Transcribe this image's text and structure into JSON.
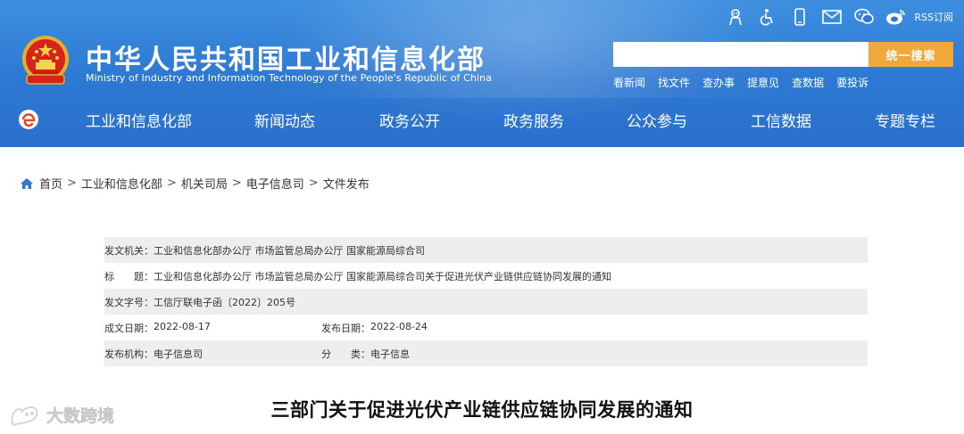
{
  "header": {
    "title_cn": "中华人民共和国工业和信息化部",
    "title_en": "Ministry of Industry and Information Technology of the People's Republic of China",
    "tools": {
      "rss_label": "RSS订阅"
    },
    "search": {
      "value": "",
      "placeholder": "",
      "button_label": "统一搜索"
    },
    "quicklinks": [
      "看新闻",
      "找文件",
      "查办事",
      "提意见",
      "查数据",
      "要投诉"
    ]
  },
  "nav": {
    "items": [
      "工业和信息化部",
      "新闻动态",
      "政务公开",
      "政务服务",
      "公众参与",
      "工信数据",
      "专题专栏"
    ]
  },
  "breadcrumb": [
    "首页",
    "工业和信息化部",
    "机关司局",
    "电子信息司",
    "文件发布"
  ],
  "meta": {
    "issuer_label": "发文机关：",
    "issuer": "工业和信息化部办公厅 市场监管总局办公厅 国家能源局综合司",
    "title_label": "标　　题：",
    "title": "工业和信息化部办公厅 市场监管总局办公厅 国家能源局综合司关于促进光伏产业链供应链协同发展的通知",
    "docno_label": "发文字号：",
    "docno": "工信厅联电子函〔2022〕205号",
    "written_label": "成文日期：",
    "written": "2022-08-17",
    "published_label": "发布日期：",
    "published": "2022-08-24",
    "agency_label": "发布机构：",
    "agency": "电子信息司",
    "category_label": "分　　类：",
    "category": "电子信息"
  },
  "article": {
    "title": "三部门关于促进光伏产业链供应链协同发展的通知"
  },
  "watermark": {
    "text": "大数跨境"
  },
  "colors": {
    "header_blue": "#2d78d2",
    "search_button": "#f0a83a",
    "meta_shade": "#eeeeee"
  }
}
